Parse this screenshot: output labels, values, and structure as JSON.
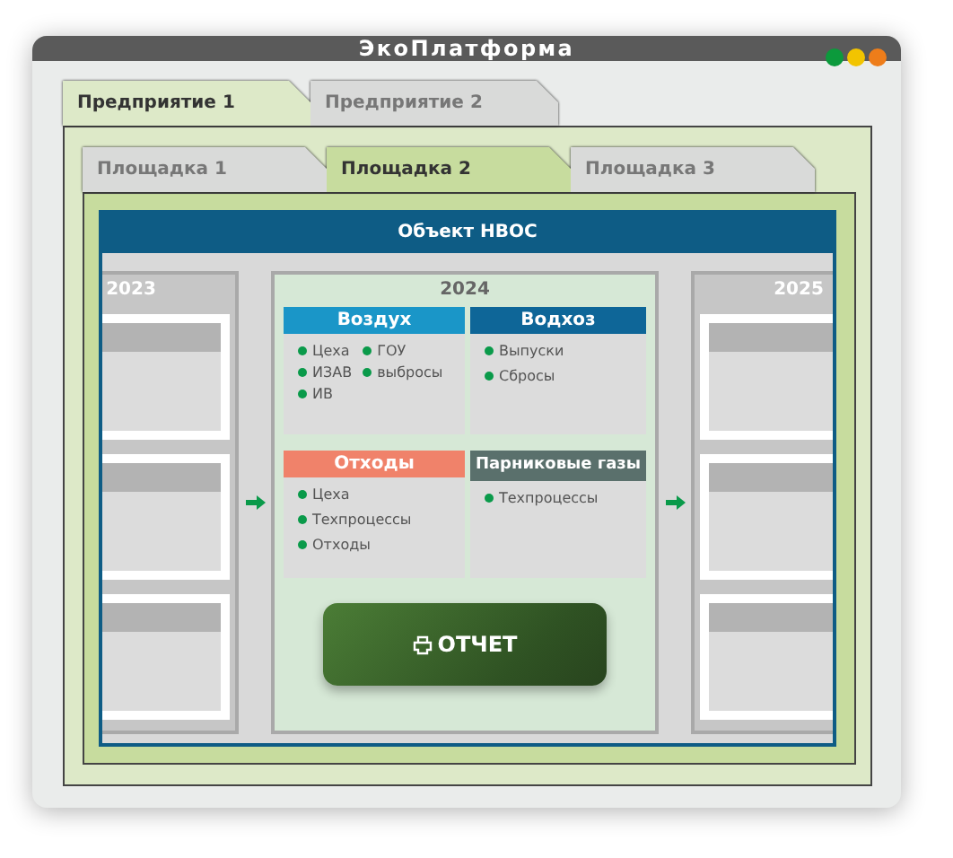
{
  "window": {
    "title": "ЭкоПлатформа"
  },
  "enterprise_tabs": [
    {
      "label": "Предприятие 1",
      "selected": true
    },
    {
      "label": "Предприятие 2",
      "selected": false
    }
  ],
  "site_tabs": [
    {
      "label": "Площадка 1",
      "selected": false
    },
    {
      "label": "Площадка 2",
      "selected": true
    },
    {
      "label": "Площадка 3",
      "selected": false
    }
  ],
  "panel": {
    "title": "Объект НВОС",
    "years": [
      {
        "year": "2023",
        "kind": "summary"
      },
      {
        "year": "2024",
        "kind": "detail",
        "categories": [
          {
            "title": "Воздух",
            "color": "#1a96c8",
            "kind": "grid",
            "items": [
              "Цеха",
              "ГОУ",
              "ИЗАВ",
              "выбросы",
              "ИВ"
            ]
          },
          {
            "title": "Водхоз",
            "color": "#0e6698",
            "kind": "list",
            "items": [
              "Выпуски",
              "Сбросы"
            ]
          },
          {
            "title": "Отходы",
            "color": "#f0826a",
            "kind": "list",
            "items": [
              "Цеха",
              "Техпроцессы",
              "Отходы"
            ]
          },
          {
            "title": "Парниковые газы",
            "color": "#5a706c",
            "kind": "list",
            "items": [
              "Техпроцессы"
            ]
          }
        ],
        "button": "ОТЧЕТ"
      },
      {
        "year": "2025",
        "kind": "summary"
      }
    ]
  }
}
